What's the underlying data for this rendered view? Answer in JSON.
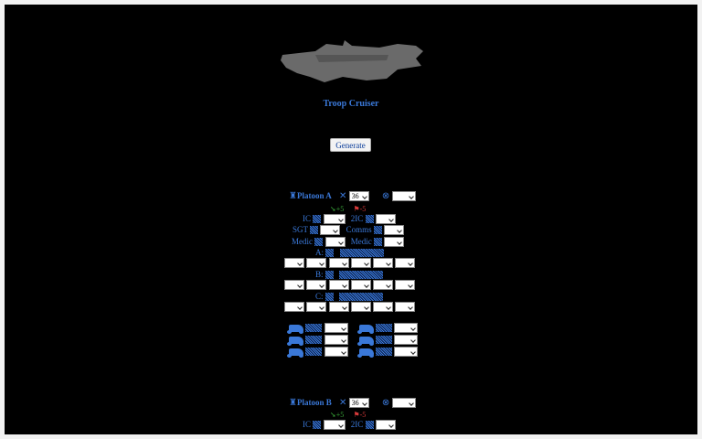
{
  "ship": {
    "name": "Troop Cruiser",
    "image_icon": "ship-silhouette"
  },
  "generate_label": "Generate",
  "platoons": [
    {
      "name": "Platoon A",
      "size_value": "36",
      "modifier_plus": "+5",
      "modifier_minus": "-5",
      "roles": {
        "ic": "IC",
        "two_ic": "2IC",
        "sgt": "SGT",
        "comms": "Comms",
        "medic1": "Medic",
        "medic2": "Medic"
      },
      "squads": [
        "A:",
        "B:",
        "C:"
      ]
    },
    {
      "name": "Platoon B",
      "size_value": "36",
      "modifier_plus": "+5",
      "modifier_minus": "-5",
      "roles": {
        "ic": "IC",
        "two_ic": "2IC"
      }
    }
  ]
}
